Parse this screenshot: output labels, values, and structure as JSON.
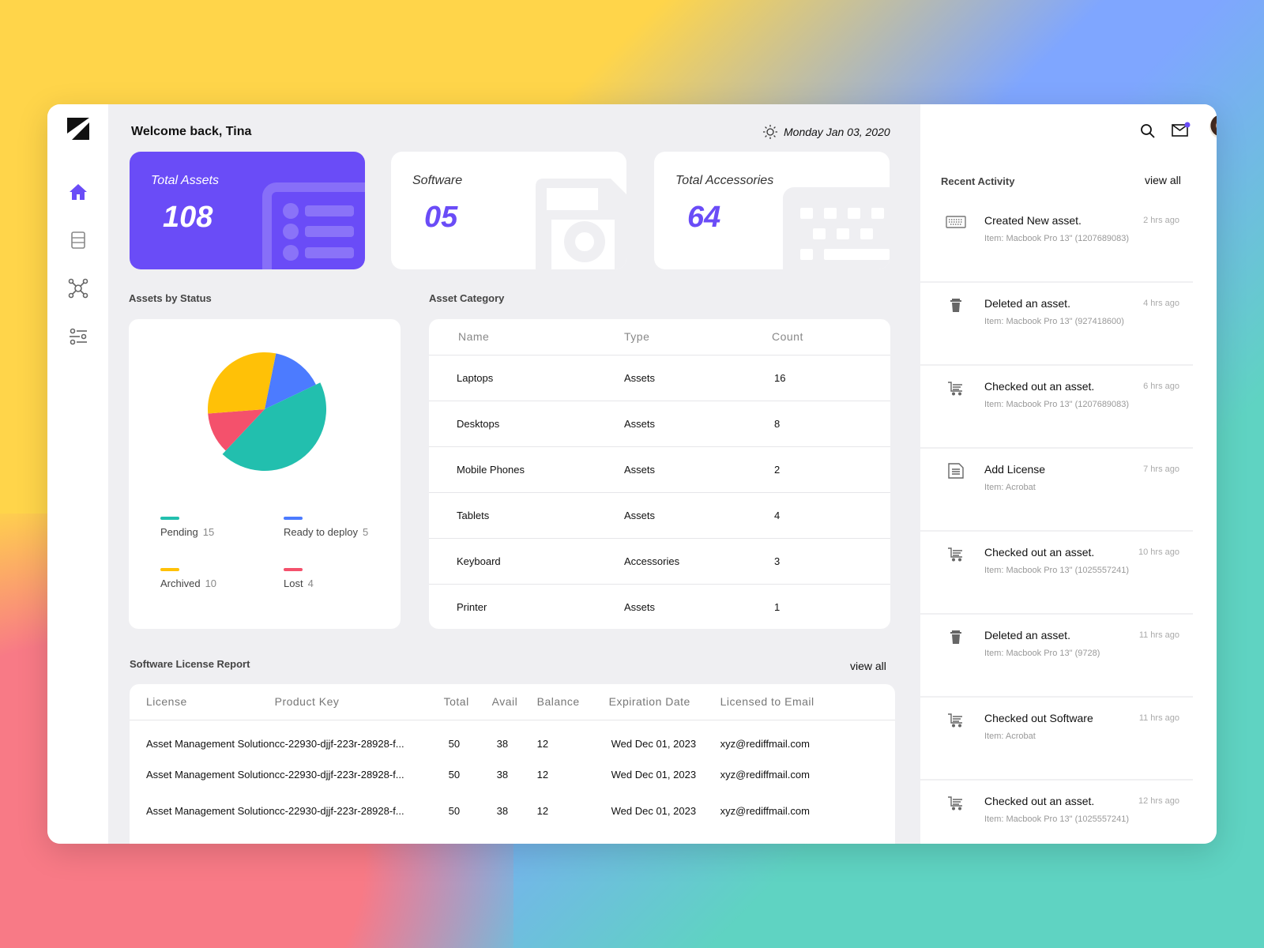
{
  "header": {
    "welcome": "Welcome back, Tina",
    "date": "Monday Jan 03, 2020"
  },
  "colors": {
    "accent": "#6a4cf7",
    "pending": "#22bfae",
    "ready": "#4c7bff",
    "archived": "#ffc107",
    "lost": "#f4516c"
  },
  "stats": [
    {
      "label": "Total Assets",
      "value": "108"
    },
    {
      "label": "Software",
      "value": "05"
    },
    {
      "label": "Total Accessories",
      "value": "64"
    }
  ],
  "sidebar": {
    "items": [
      {
        "icon": "home-icon",
        "active": true
      },
      {
        "icon": "server-icon"
      },
      {
        "icon": "network-icon"
      },
      {
        "icon": "sliders-icon"
      }
    ]
  },
  "status": {
    "title": "Assets by Status",
    "legend": [
      {
        "label": "Pending",
        "count": "15"
      },
      {
        "label": "Ready to deploy",
        "count": "5"
      },
      {
        "label": "Archived",
        "count": "10"
      },
      {
        "label": "Lost",
        "count": "4"
      }
    ]
  },
  "chart_data": {
    "type": "pie",
    "labels": [
      "Pending",
      "Ready to deploy",
      "Archived",
      "Lost"
    ],
    "values": [
      15,
      5,
      10,
      4
    ],
    "colors": [
      "#22bfae",
      "#4c7bff",
      "#ffc107",
      "#f4516c"
    ],
    "legend": "bottom"
  },
  "category": {
    "title": "Asset Category",
    "headers": [
      "Name",
      "Type",
      "Count"
    ],
    "rows": [
      [
        "Laptops",
        "Assets",
        "16"
      ],
      [
        "Desktops",
        "Assets",
        "8"
      ],
      [
        "Mobile Phones",
        "Assets",
        "2"
      ],
      [
        "Tablets",
        "Assets",
        "4"
      ],
      [
        "Keyboard",
        "Accessories",
        "3"
      ],
      [
        "Printer",
        "Assets",
        "1"
      ]
    ]
  },
  "license": {
    "title": "Software License Report",
    "view_all": "view all",
    "headers": [
      "License",
      "Product Key",
      "Total",
      "Avail",
      "Balance",
      "Expiration Date",
      "Licensed to Email"
    ],
    "rows": [
      [
        "Asset Management Solution",
        "cc-22930-djjf-223r-28928-f...",
        "50",
        "38",
        "12",
        "Wed Dec 01, 2023",
        "xyz@rediffmail.com"
      ],
      [
        "Asset Management Solution",
        "cc-22930-djjf-223r-28928-f...",
        "50",
        "38",
        "12",
        "Wed Dec 01, 2023",
        "xyz@rediffmail.com"
      ],
      [
        "Asset Management Solution",
        "cc-22930-djjf-223r-28928-f...",
        "50",
        "38",
        "12",
        "Wed Dec 01, 2023",
        "xyz@rediffmail.com"
      ]
    ]
  },
  "activity": {
    "title": "Recent Activity",
    "view_all": "view all",
    "items": [
      {
        "icon": "keyboard",
        "title": "Created New asset.",
        "sub": "Item: Macbook Pro 13\" (1207689083)",
        "time": "2 hrs ago"
      },
      {
        "icon": "trash",
        "title": "Deleted an asset.",
        "sub": "Item: Macbook Pro 13\" (927418600)",
        "time": "4 hrs ago"
      },
      {
        "icon": "cart",
        "title": "Checked out an asset.",
        "sub": "Item: Macbook Pro 13\" (1207689083)",
        "time": "6 hrs ago"
      },
      {
        "icon": "document",
        "title": "Add License",
        "sub": "Item: Acrobat",
        "time": "7 hrs ago"
      },
      {
        "icon": "cart",
        "title": "Checked out an asset.",
        "sub": "Item: Macbook Pro 13\" (1025557241)",
        "time": "10 hrs ago"
      },
      {
        "icon": "trash",
        "title": "Deleted an asset.",
        "sub": "Item: Macbook Pro 13\" (9728)",
        "time": "11 hrs ago"
      },
      {
        "icon": "cart",
        "title": "Checked out Software",
        "sub": "Item: Acrobat",
        "time": "11 hrs ago"
      },
      {
        "icon": "cart",
        "title": "Checked out an asset.",
        "sub": "Item: Macbook Pro 13\" (1025557241)",
        "time": "12 hrs ago"
      }
    ]
  }
}
